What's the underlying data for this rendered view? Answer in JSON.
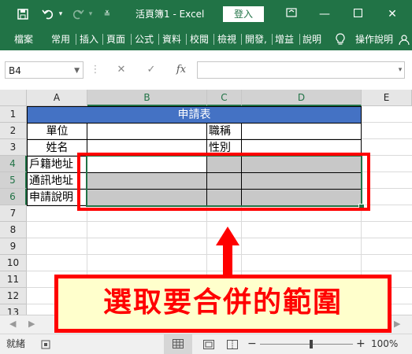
{
  "titlebar": {
    "title": "活頁簿1  -  Excel",
    "login_label": "登入",
    "save_icon": "save-icon",
    "undo_icon": "undo-icon",
    "redo_icon": "redo-icon",
    "customize_icon": "customize-toolbar-icon",
    "restore_icon": "restore-window-icon",
    "minimize_icon": "minimize-icon",
    "maximize_icon": "maximize-icon",
    "close_icon": "close-icon",
    "bg_color": "#217346"
  },
  "ribbon": {
    "tabs": [
      "檔案",
      "常用",
      "插入",
      "頁面",
      "公式",
      "資料",
      "校閱",
      "檢視",
      "開發,",
      "增益",
      "說明"
    ],
    "tell_me": "操作說明",
    "lightbulb_icon": "lightbulb-icon",
    "share_icon": "share-icon"
  },
  "formula_bar": {
    "name_box": "B4",
    "cancel_icon": "✕",
    "enter_icon": "✓",
    "fx_label": "fx",
    "value": ""
  },
  "sheet": {
    "columns": [
      "A",
      "B",
      "C",
      "D",
      "E"
    ],
    "selected_columns": [
      "B",
      "C",
      "D"
    ],
    "rows": [
      "1",
      "2",
      "3",
      "4",
      "5",
      "6",
      "7",
      "8",
      "9",
      "10",
      "11",
      "12",
      "13"
    ],
    "selected_rows": [
      "4",
      "5",
      "6"
    ],
    "header_title": "申請表",
    "labels": {
      "a2": "單位",
      "a3": "姓名",
      "a4": "戶籍地址",
      "a5": "通訊地址",
      "a6": "申請說明",
      "c2": "職稱",
      "c3": "性別"
    },
    "header_color": "#4472c4",
    "selection_fill": "#c8c8c8"
  },
  "annotation": {
    "text": "選取要合併的範圍",
    "color": "#ff0000",
    "bg": "#ffffcc"
  },
  "status": {
    "ready": "就緒",
    "zoom": "100%",
    "zoom_minus": "−",
    "zoom_plus": "+"
  }
}
